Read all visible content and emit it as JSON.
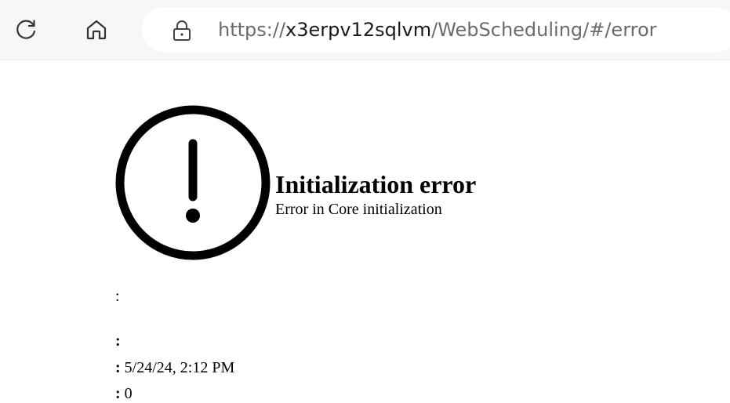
{
  "browser": {
    "url_scheme": "https://",
    "url_host": "x3erpv12sqlvm",
    "url_path": "/WebScheduling/#/error",
    "icons": [
      "refresh-icon",
      "home-icon",
      "lock-icon"
    ]
  },
  "error": {
    "icon": "exclamation-circle-icon",
    "title": "Initialization error",
    "message": "Error in Core initialization"
  },
  "details": {
    "line1_label": ":",
    "line2_label": ":",
    "line3_label": ":",
    "line3_value": "5/24/24, 2:12 PM",
    "line4_label": ":",
    "line4_value": "0"
  }
}
